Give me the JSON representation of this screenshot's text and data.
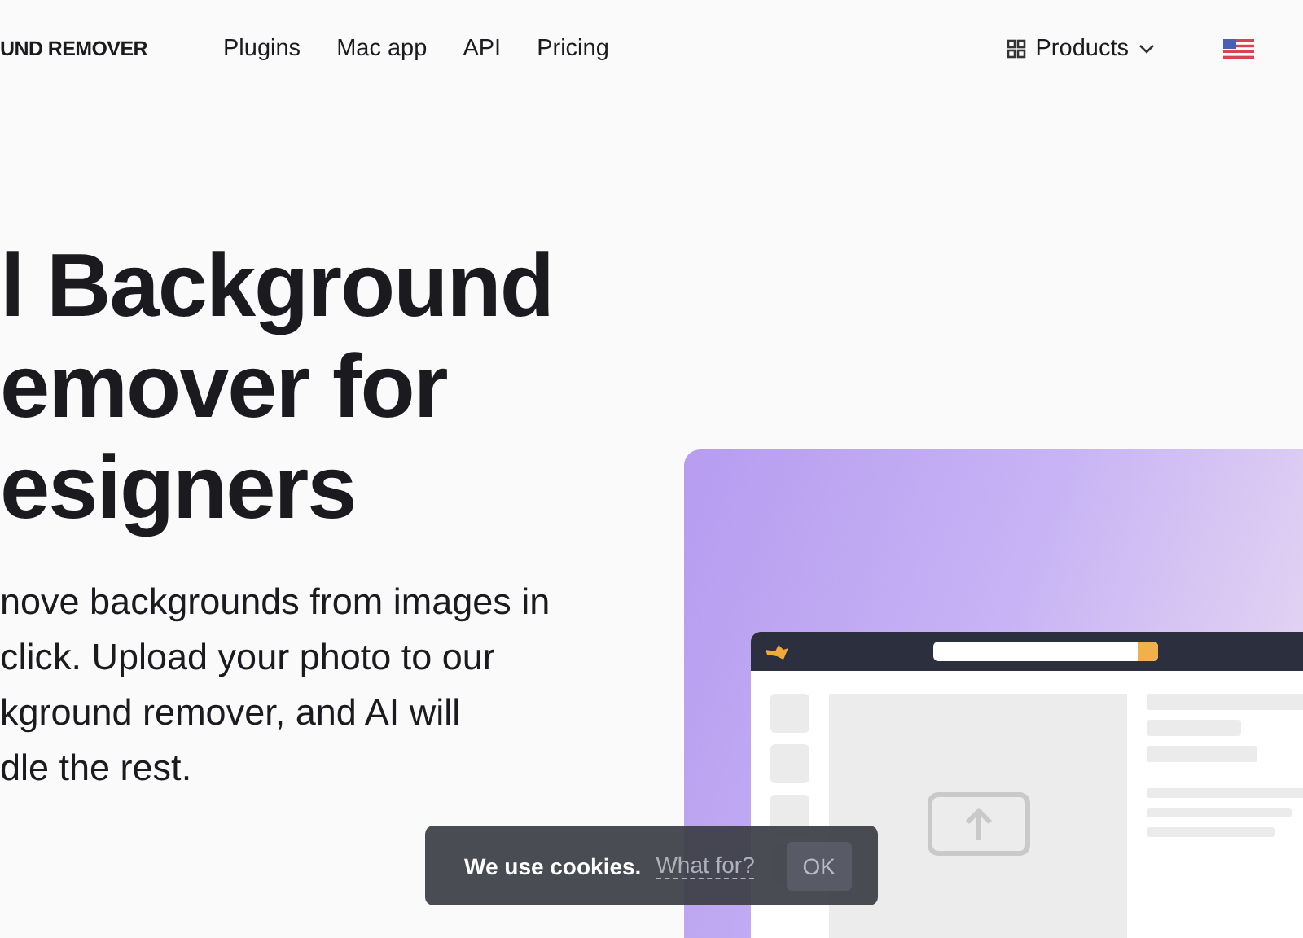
{
  "header": {
    "logo": "UND REMOVER",
    "nav": [
      "Plugins",
      "Mac app",
      "API",
      "Pricing"
    ],
    "products": "Products"
  },
  "hero": {
    "heading_lines": [
      "l Background",
      "emover for",
      "esigners"
    ],
    "description_lines": [
      "nove backgrounds from images in",
      "click. Upload your photo to our",
      "kground remover, and AI will",
      "dle the rest."
    ]
  },
  "cookie_banner": {
    "message": "We use cookies.",
    "link": "What for?",
    "button": "OK"
  }
}
